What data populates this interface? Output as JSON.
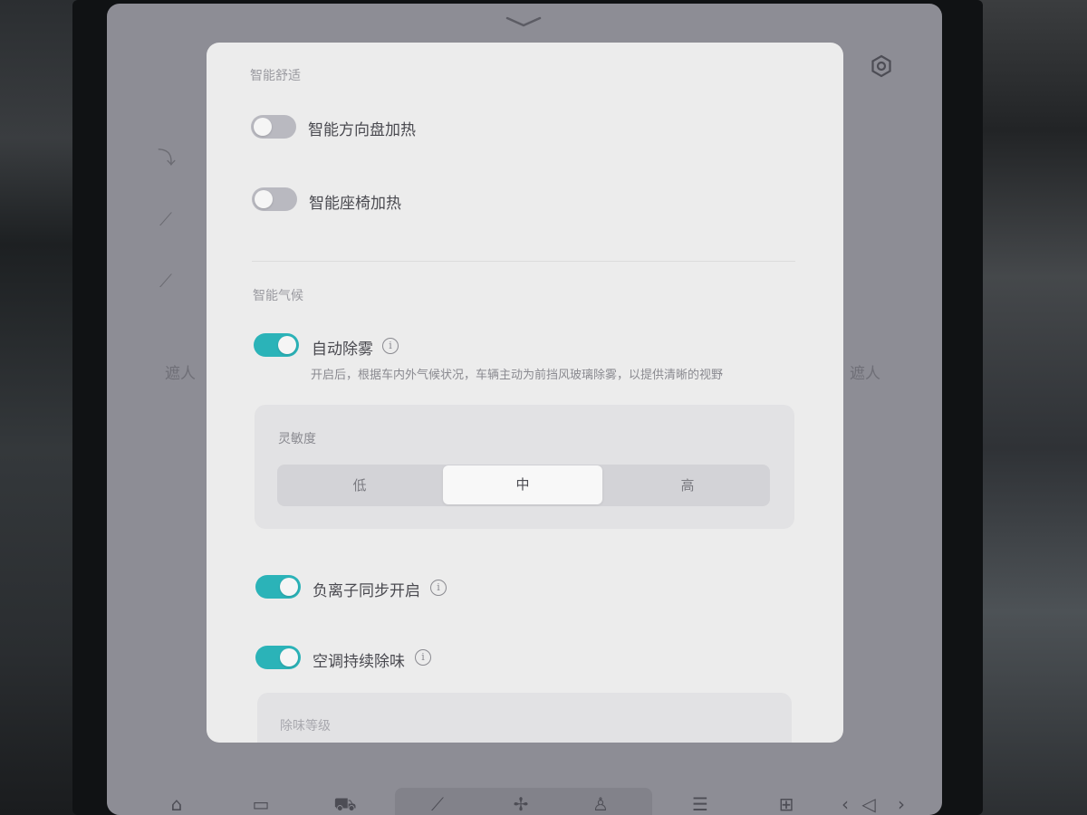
{
  "background": {
    "left_label": "遮人",
    "right_label": "遮人"
  },
  "panel": {
    "comfort_section": {
      "title": "智能舒适",
      "steering_heat": {
        "label": "智能方向盘加热",
        "enabled": false
      },
      "seat_heat": {
        "label": "智能座椅加热",
        "enabled": false
      }
    },
    "climate_section": {
      "title": "智能气候",
      "auto_defog": {
        "label": "自动除雾",
        "enabled": true,
        "description": "开启后，根据车内外气候状况，车辆主动为前挡风玻璃除雾，以提供清晰的视野"
      },
      "sensitivity": {
        "title": "灵敏度",
        "options": [
          "低",
          "中",
          "高"
        ],
        "selected": "中"
      },
      "anion_sync": {
        "label": "负离子同步开启",
        "enabled": true
      },
      "ac_deodorize": {
        "label": "空调持续除味",
        "enabled": true
      },
      "deodorize_level": {
        "title": "除味等级"
      }
    }
  },
  "icons": {
    "info": "i",
    "settings": "gear-icon",
    "pull_handle": "chevron-down-icon"
  },
  "colors": {
    "toggle_on": "#2bb3b8",
    "toggle_off": "#b9b9c0",
    "panel_bg": "#ececec",
    "screen_bg": "#8d8d95"
  }
}
